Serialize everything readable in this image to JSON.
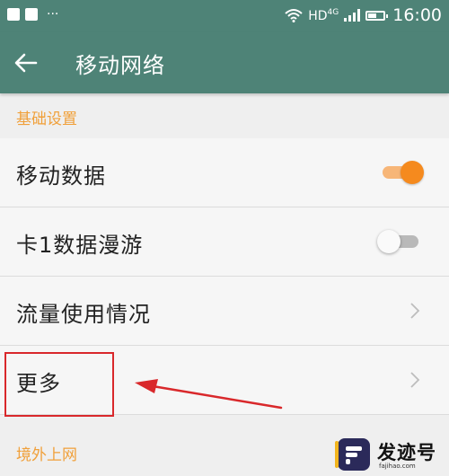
{
  "status_bar": {
    "left_dots": "···",
    "hd": "HD",
    "network": "4G",
    "time": "16:00"
  },
  "toolbar": {
    "title": "移动网络"
  },
  "sections": [
    {
      "header": "基础设置",
      "items": [
        {
          "label": "移动数据",
          "control": "switch",
          "on": true
        },
        {
          "label": "卡1数据漫游",
          "control": "switch",
          "on": false
        },
        {
          "label": "流量使用情况",
          "control": "chevron"
        },
        {
          "label": "更多",
          "control": "chevron"
        }
      ]
    },
    {
      "header": "境外上网"
    }
  ],
  "watermark": {
    "name": "发迹号",
    "url": "fajihao.com"
  },
  "colors": {
    "toolbar": "#4e8377",
    "accent": "#f58a1e",
    "section_header": "#f0a03a",
    "annotation": "#d9282b"
  }
}
